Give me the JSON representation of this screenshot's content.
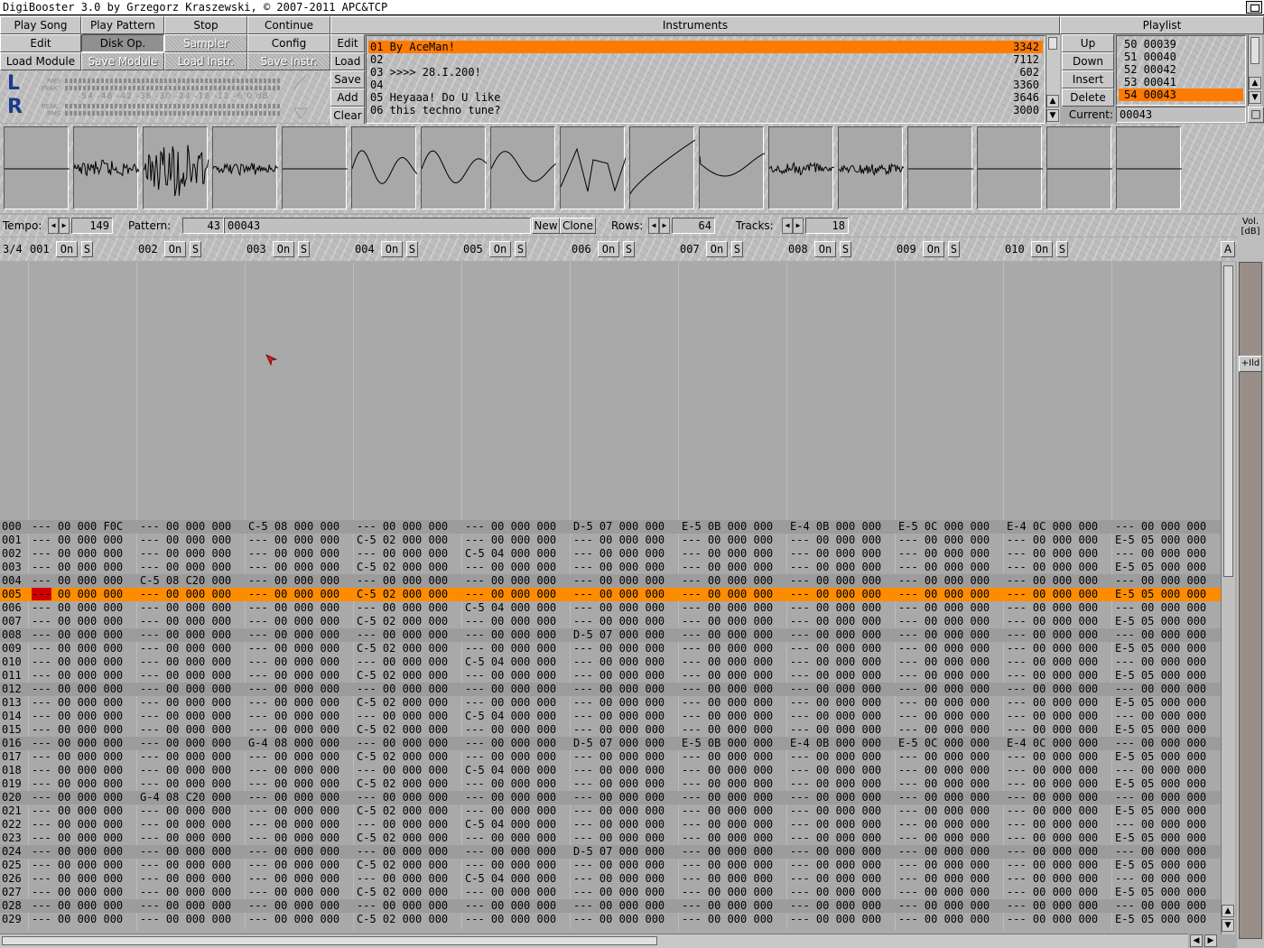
{
  "window": {
    "title": "DigiBooster 3.0 by Grzegorz Kraszewski, © 2007-2011 APC&TCP"
  },
  "buttons": {
    "play_song": "Play Song",
    "play_pattern": "Play Pattern",
    "stop": "Stop",
    "continue": "Continue",
    "edit": "Edit",
    "disk_op": "Disk Op.",
    "sampler": "Sampler",
    "config": "Config",
    "load_module": "Load Module",
    "save_module": "Save Module",
    "load_instr": "Load Instr.",
    "save_instr": "Save Instr."
  },
  "instrument_buttons": [
    "Edit",
    "Load",
    "Save",
    "Add",
    "Clear"
  ],
  "instruments": {
    "header": "Instruments",
    "items": [
      {
        "name": "01 By AceMan!",
        "size": "3342",
        "selected": true
      },
      {
        "name": "02",
        "size": "7112"
      },
      {
        "name": "03 >>>> 28.I.200!",
        "size": "602"
      },
      {
        "name": "04",
        "size": "3360"
      },
      {
        "name": "05 Heyaaa! Do U like",
        "size": "3646"
      },
      {
        "name": "06 this techno tune?",
        "size": "3000"
      }
    ]
  },
  "playlist": {
    "header": "Playlist",
    "buttons": [
      "Up",
      "Down",
      "Insert",
      "Delete"
    ],
    "items": [
      "50 00039",
      "51 00040",
      "52 00042",
      "53 00041",
      "54 00043"
    ],
    "selected_index": 4,
    "current_label": "Current:",
    "current_value": "00043"
  },
  "vu": {
    "left": "L",
    "right": "R",
    "scale": "-54 -48 -42 -36 -30 -24 -18 -12  -6   0 dB",
    "rms": "RMS",
    "peak": "PEAK"
  },
  "controls": {
    "tempo_label": "Tempo:",
    "tempo": "149",
    "pattern_label": "Pattern:",
    "pattern_num": "43",
    "pattern_name": "00043",
    "new": "New",
    "clone": "Clone",
    "rows_label": "Rows:",
    "rows": "64",
    "tracks_label": "Tracks:",
    "tracks": "18",
    "vol_label_1": "Vol.",
    "vol_label_2": "[dB]",
    "ild": "+Ild",
    "a": "A"
  },
  "tracks": {
    "page": "3/4",
    "on": "On",
    "s": "S",
    "ids": [
      "001",
      "002",
      "003",
      "004",
      "005",
      "006",
      "007",
      "008",
      "009",
      "010"
    ]
  },
  "pattern_rows": [
    [
      "000",
      "--- 00 000 F0C",
      "--- 00 000 000",
      "C-5 08 000 000",
      "--- 00 000 000",
      "--- 00 000 000",
      "D-5 07 000 000",
      "E-5 0B 000 000",
      "E-4 0B 000 000",
      "E-5 0C 000 000",
      "E-4 0C 000 000",
      "--- 00 000 000"
    ],
    [
      "001",
      "--- 00 000 000",
      "--- 00 000 000",
      "--- 00 000 000",
      "C-5 02 000 000",
      "--- 00 000 000",
      "--- 00 000 000",
      "--- 00 000 000",
      "--- 00 000 000",
      "--- 00 000 000",
      "--- 00 000 000",
      "E-5 05 000 000"
    ],
    [
      "002",
      "--- 00 000 000",
      "--- 00 000 000",
      "--- 00 000 000",
      "--- 00 000 000",
      "C-5 04 000 000",
      "--- 00 000 000",
      "--- 00 000 000",
      "--- 00 000 000",
      "--- 00 000 000",
      "--- 00 000 000",
      "--- 00 000 000"
    ],
    [
      "003",
      "--- 00 000 000",
      "--- 00 000 000",
      "--- 00 000 000",
      "C-5 02 000 000",
      "--- 00 000 000",
      "--- 00 000 000",
      "--- 00 000 000",
      "--- 00 000 000",
      "--- 00 000 000",
      "--- 00 000 000",
      "E-5 05 000 000"
    ],
    [
      "004",
      "--- 00 000 000",
      "C-5 08 C20 000",
      "--- 00 000 000",
      "--- 00 000 000",
      "--- 00 000 000",
      "--- 00 000 000",
      "--- 00 000 000",
      "--- 00 000 000",
      "--- 00 000 000",
      "--- 00 000 000",
      "--- 00 000 000"
    ],
    [
      "005",
      "--- 00 000 000",
      "--- 00 000 000",
      "--- 00 000 000",
      "C-5 02 000 000",
      "--- 00 000 000",
      "--- 00 000 000",
      "--- 00 000 000",
      "--- 00 000 000",
      "--- 00 000 000",
      "--- 00 000 000",
      "E-5 05 000 000"
    ],
    [
      "006",
      "--- 00 000 000",
      "--- 00 000 000",
      "--- 00 000 000",
      "--- 00 000 000",
      "C-5 04 000 000",
      "--- 00 000 000",
      "--- 00 000 000",
      "--- 00 000 000",
      "--- 00 000 000",
      "--- 00 000 000",
      "--- 00 000 000"
    ],
    [
      "007",
      "--- 00 000 000",
      "--- 00 000 000",
      "--- 00 000 000",
      "C-5 02 000 000",
      "--- 00 000 000",
      "--- 00 000 000",
      "--- 00 000 000",
      "--- 00 000 000",
      "--- 00 000 000",
      "--- 00 000 000",
      "E-5 05 000 000"
    ],
    [
      "008",
      "--- 00 000 000",
      "--- 00 000 000",
      "--- 00 000 000",
      "--- 00 000 000",
      "--- 00 000 000",
      "D-5 07 000 000",
      "--- 00 000 000",
      "--- 00 000 000",
      "--- 00 000 000",
      "--- 00 000 000",
      "--- 00 000 000"
    ],
    [
      "009",
      "--- 00 000 000",
      "--- 00 000 000",
      "--- 00 000 000",
      "C-5 02 000 000",
      "--- 00 000 000",
      "--- 00 000 000",
      "--- 00 000 000",
      "--- 00 000 000",
      "--- 00 000 000",
      "--- 00 000 000",
      "E-5 05 000 000"
    ],
    [
      "010",
      "--- 00 000 000",
      "--- 00 000 000",
      "--- 00 000 000",
      "--- 00 000 000",
      "C-5 04 000 000",
      "--- 00 000 000",
      "--- 00 000 000",
      "--- 00 000 000",
      "--- 00 000 000",
      "--- 00 000 000",
      "--- 00 000 000"
    ],
    [
      "011",
      "--- 00 000 000",
      "--- 00 000 000",
      "--- 00 000 000",
      "C-5 02 000 000",
      "--- 00 000 000",
      "--- 00 000 000",
      "--- 00 000 000",
      "--- 00 000 000",
      "--- 00 000 000",
      "--- 00 000 000",
      "E-5 05 000 000"
    ],
    [
      "012",
      "--- 00 000 000",
      "--- 00 000 000",
      "--- 00 000 000",
      "--- 00 000 000",
      "--- 00 000 000",
      "--- 00 000 000",
      "--- 00 000 000",
      "--- 00 000 000",
      "--- 00 000 000",
      "--- 00 000 000",
      "--- 00 000 000"
    ],
    [
      "013",
      "--- 00 000 000",
      "--- 00 000 000",
      "--- 00 000 000",
      "C-5 02 000 000",
      "--- 00 000 000",
      "--- 00 000 000",
      "--- 00 000 000",
      "--- 00 000 000",
      "--- 00 000 000",
      "--- 00 000 000",
      "E-5 05 000 000"
    ],
    [
      "014",
      "--- 00 000 000",
      "--- 00 000 000",
      "--- 00 000 000",
      "--- 00 000 000",
      "C-5 04 000 000",
      "--- 00 000 000",
      "--- 00 000 000",
      "--- 00 000 000",
      "--- 00 000 000",
      "--- 00 000 000",
      "--- 00 000 000"
    ],
    [
      "015",
      "--- 00 000 000",
      "--- 00 000 000",
      "--- 00 000 000",
      "C-5 02 000 000",
      "--- 00 000 000",
      "--- 00 000 000",
      "--- 00 000 000",
      "--- 00 000 000",
      "--- 00 000 000",
      "--- 00 000 000",
      "E-5 05 000 000"
    ],
    [
      "016",
      "--- 00 000 000",
      "--- 00 000 000",
      "G-4 08 000 000",
      "--- 00 000 000",
      "--- 00 000 000",
      "D-5 07 000 000",
      "E-5 0B 000 000",
      "E-4 0B 000 000",
      "E-5 0C 000 000",
      "E-4 0C 000 000",
      "--- 00 000 000"
    ],
    [
      "017",
      "--- 00 000 000",
      "--- 00 000 000",
      "--- 00 000 000",
      "C-5 02 000 000",
      "--- 00 000 000",
      "--- 00 000 000",
      "--- 00 000 000",
      "--- 00 000 000",
      "--- 00 000 000",
      "--- 00 000 000",
      "E-5 05 000 000"
    ],
    [
      "018",
      "--- 00 000 000",
      "--- 00 000 000",
      "--- 00 000 000",
      "--- 00 000 000",
      "C-5 04 000 000",
      "--- 00 000 000",
      "--- 00 000 000",
      "--- 00 000 000",
      "--- 00 000 000",
      "--- 00 000 000",
      "--- 00 000 000"
    ],
    [
      "019",
      "--- 00 000 000",
      "--- 00 000 000",
      "--- 00 000 000",
      "C-5 02 000 000",
      "--- 00 000 000",
      "--- 00 000 000",
      "--- 00 000 000",
      "--- 00 000 000",
      "--- 00 000 000",
      "--- 00 000 000",
      "E-5 05 000 000"
    ],
    [
      "020",
      "--- 00 000 000",
      "G-4 08 C20 000",
      "--- 00 000 000",
      "--- 00 000 000",
      "--- 00 000 000",
      "--- 00 000 000",
      "--- 00 000 000",
      "--- 00 000 000",
      "--- 00 000 000",
      "--- 00 000 000",
      "--- 00 000 000"
    ],
    [
      "021",
      "--- 00 000 000",
      "--- 00 000 000",
      "--- 00 000 000",
      "C-5 02 000 000",
      "--- 00 000 000",
      "--- 00 000 000",
      "--- 00 000 000",
      "--- 00 000 000",
      "--- 00 000 000",
      "--- 00 000 000",
      "E-5 05 000 000"
    ],
    [
      "022",
      "--- 00 000 000",
      "--- 00 000 000",
      "--- 00 000 000",
      "--- 00 000 000",
      "C-5 04 000 000",
      "--- 00 000 000",
      "--- 00 000 000",
      "--- 00 000 000",
      "--- 00 000 000",
      "--- 00 000 000",
      "--- 00 000 000"
    ],
    [
      "023",
      "--- 00 000 000",
      "--- 00 000 000",
      "--- 00 000 000",
      "C-5 02 000 000",
      "--- 00 000 000",
      "--- 00 000 000",
      "--- 00 000 000",
      "--- 00 000 000",
      "--- 00 000 000",
      "--- 00 000 000",
      "E-5 05 000 000"
    ],
    [
      "024",
      "--- 00 000 000",
      "--- 00 000 000",
      "--- 00 000 000",
      "--- 00 000 000",
      "--- 00 000 000",
      "D-5 07 000 000",
      "--- 00 000 000",
      "--- 00 000 000",
      "--- 00 000 000",
      "--- 00 000 000",
      "--- 00 000 000"
    ],
    [
      "025",
      "--- 00 000 000",
      "--- 00 000 000",
      "--- 00 000 000",
      "C-5 02 000 000",
      "--- 00 000 000",
      "--- 00 000 000",
      "--- 00 000 000",
      "--- 00 000 000",
      "--- 00 000 000",
      "--- 00 000 000",
      "E-5 05 000 000"
    ],
    [
      "026",
      "--- 00 000 000",
      "--- 00 000 000",
      "--- 00 000 000",
      "--- 00 000 000",
      "C-5 04 000 000",
      "--- 00 000 000",
      "--- 00 000 000",
      "--- 00 000 000",
      "--- 00 000 000",
      "--- 00 000 000",
      "--- 00 000 000"
    ],
    [
      "027",
      "--- 00 000 000",
      "--- 00 000 000",
      "--- 00 000 000",
      "C-5 02 000 000",
      "--- 00 000 000",
      "--- 00 000 000",
      "--- 00 000 000",
      "--- 00 000 000",
      "--- 00 000 000",
      "--- 00 000 000",
      "E-5 05 000 000"
    ],
    [
      "028",
      "--- 00 000 000",
      "--- 00 000 000",
      "--- 00 000 000",
      "--- 00 000 000",
      "--- 00 000 000",
      "--- 00 000 000",
      "--- 00 000 000",
      "--- 00 000 000",
      "--- 00 000 000",
      "--- 00 000 000",
      "--- 00 000 000"
    ],
    [
      "029",
      "--- 00 000 000",
      "--- 00 000 000",
      "--- 00 000 000",
      "C-5 02 000 000",
      "--- 00 000 000",
      "--- 00 000 000",
      "--- 00 000 000",
      "--- 00 000 000",
      "--- 00 000 000",
      "--- 00 000 000",
      "E-5 05 000 000"
    ]
  ],
  "current_row": 5,
  "colors": {
    "highlight": "#ff7a00",
    "cursor": "#d00000",
    "vu_letters": "#1a3a8a"
  }
}
